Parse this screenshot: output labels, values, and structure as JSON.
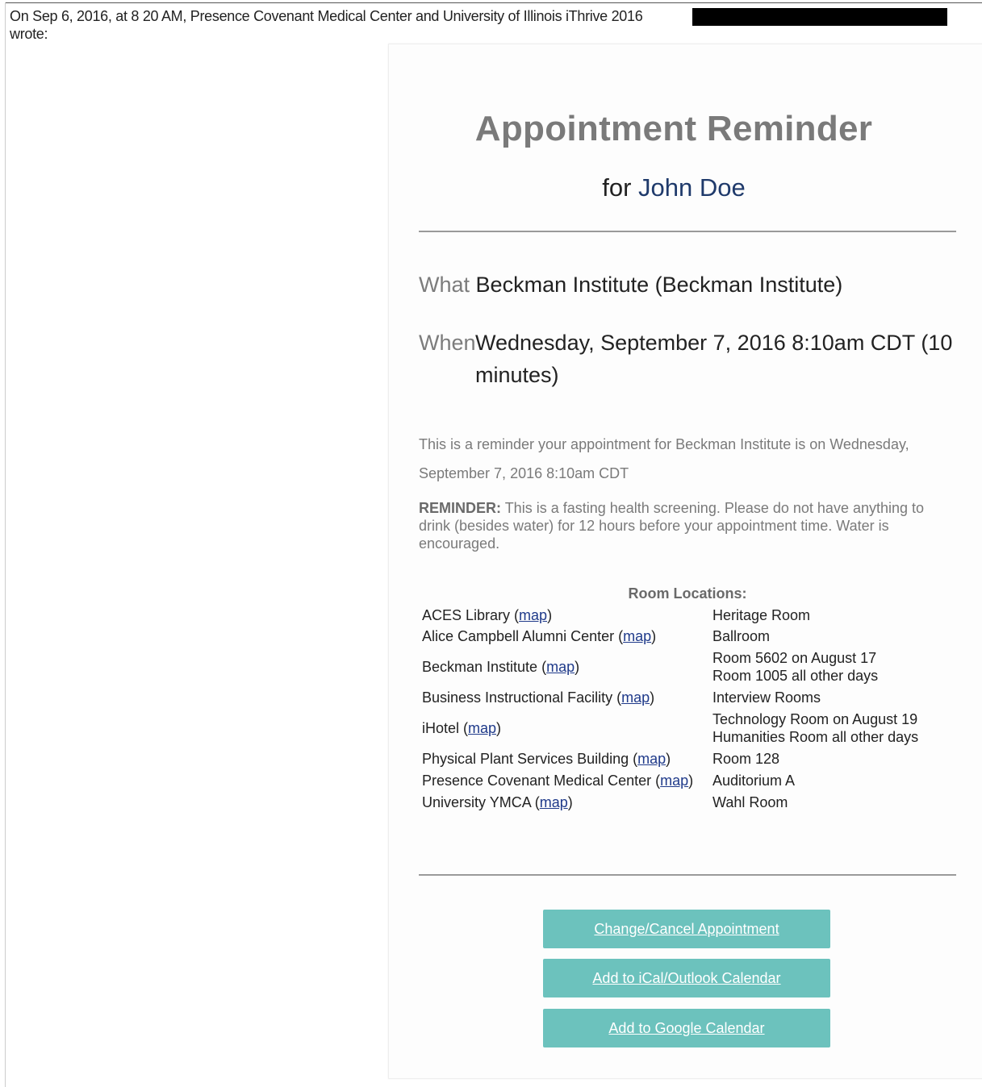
{
  "email": {
    "header_line1": "On Sep 6, 2016, at 8  20 AM, Presence Covenant Medical Center and University of Illinois iThrive 2016",
    "header_line2": "wrote:"
  },
  "reminder": {
    "title": "Appointment Reminder",
    "for_label": "for",
    "name": "John Doe",
    "what_label": "What",
    "what_value": "Beckman Institute (Beckman Institute)",
    "when_label": "When",
    "when_value": "Wednesday, September 7, 2016 8:10am CDT (10 minutes)",
    "message": "This is a reminder your appointment for Beckman Institute is on Wednesday, September 7, 2016 8:10am CDT",
    "reminder_label": "REMINDER:",
    "reminder_text": "This is a fasting health screening. Please do not have anything to drink (besides water) for 12 hours before your appointment time. Water is encouraged."
  },
  "rooms": {
    "title": "Room Locations:",
    "map_label": "map",
    "items": [
      {
        "place": "ACES Library",
        "room": "Heritage Room"
      },
      {
        "place": "Alice Campbell Alumni Center",
        "room": "Ballroom"
      },
      {
        "place": "Beckman Institute",
        "room": "Room 5602 on August 17",
        "room2": "Room 1005 all other days"
      },
      {
        "place": "Business Instructional Facility",
        "room": "Interview Rooms"
      },
      {
        "place": "iHotel",
        "room": "Technology Room on August 19",
        "room2": "Humanities Room all other days"
      },
      {
        "place": "Physical Plant Services Building",
        "room": "Room 128"
      },
      {
        "place": "Presence Covenant Medical Center",
        "room": "Auditorium A"
      },
      {
        "place": "University YMCA",
        "room": "Wahl Room"
      }
    ]
  },
  "buttons": {
    "change_cancel": "Change/Cancel Appointment",
    "ical": "Add to iCal/Outlook Calendar",
    "google": "Add to Google Calendar"
  },
  "colors": {
    "button_bg": "#6cc2bd",
    "name_color": "#1f3a6b",
    "title_color": "#7a7a7a",
    "link_color": "#1f3a8a"
  }
}
